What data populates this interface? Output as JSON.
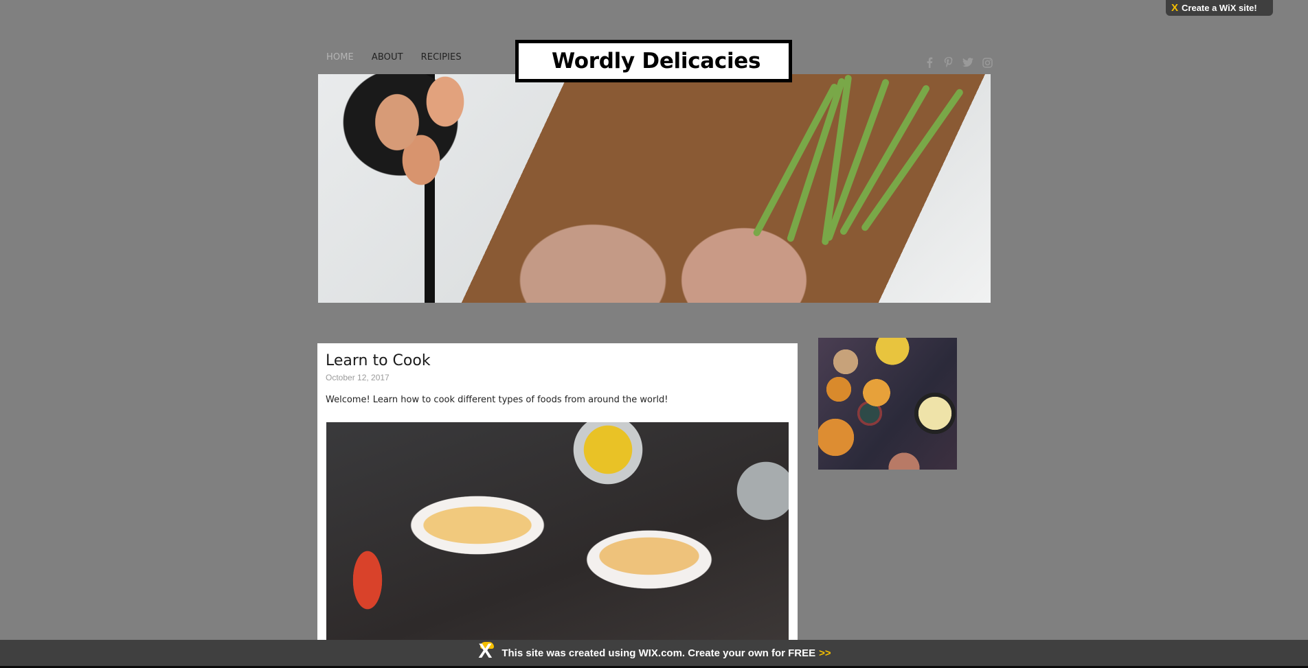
{
  "wix_badge": {
    "icon": "wix-x-logo",
    "label": "Create a WiX  site!"
  },
  "nav": {
    "items": [
      {
        "label": "HOME",
        "active": true
      },
      {
        "label": "ABOUT",
        "active": false
      },
      {
        "label": "RECIPIES",
        "active": false
      }
    ]
  },
  "site": {
    "title": "Wordly Delicacies"
  },
  "social": [
    {
      "icon": "facebook-icon",
      "glyph": "f"
    },
    {
      "icon": "pinterest-icon",
      "glyph": "p"
    },
    {
      "icon": "twitter-icon",
      "glyph": "t"
    },
    {
      "icon": "instagram-icon",
      "glyph": "i"
    }
  ],
  "banner": {
    "alt": "Hands cracking eggs into a bowl beside a cast-iron pan of eggs, zucchini and asparagus on a wooden board"
  },
  "post": {
    "title": "Learn to Cook",
    "date": "October 12, 2017",
    "body": "Welcome! Learn how to cook different types of foods from around the world!",
    "image_alt": "Hot dogs with pickles, mustard and crispy onions on paper trays"
  },
  "sidebar": {
    "image_alt": "Table of nachos, dips and shared dishes viewed from above"
  },
  "footer": {
    "message": "This site was created using WIX.com. Create your own for FREE",
    "arrows": ">>"
  },
  "colors": {
    "page_bg": "#808080",
    "wix_dark": "#404040",
    "wix_accent": "#f5c000",
    "nav_active": "#b5b5b5"
  }
}
